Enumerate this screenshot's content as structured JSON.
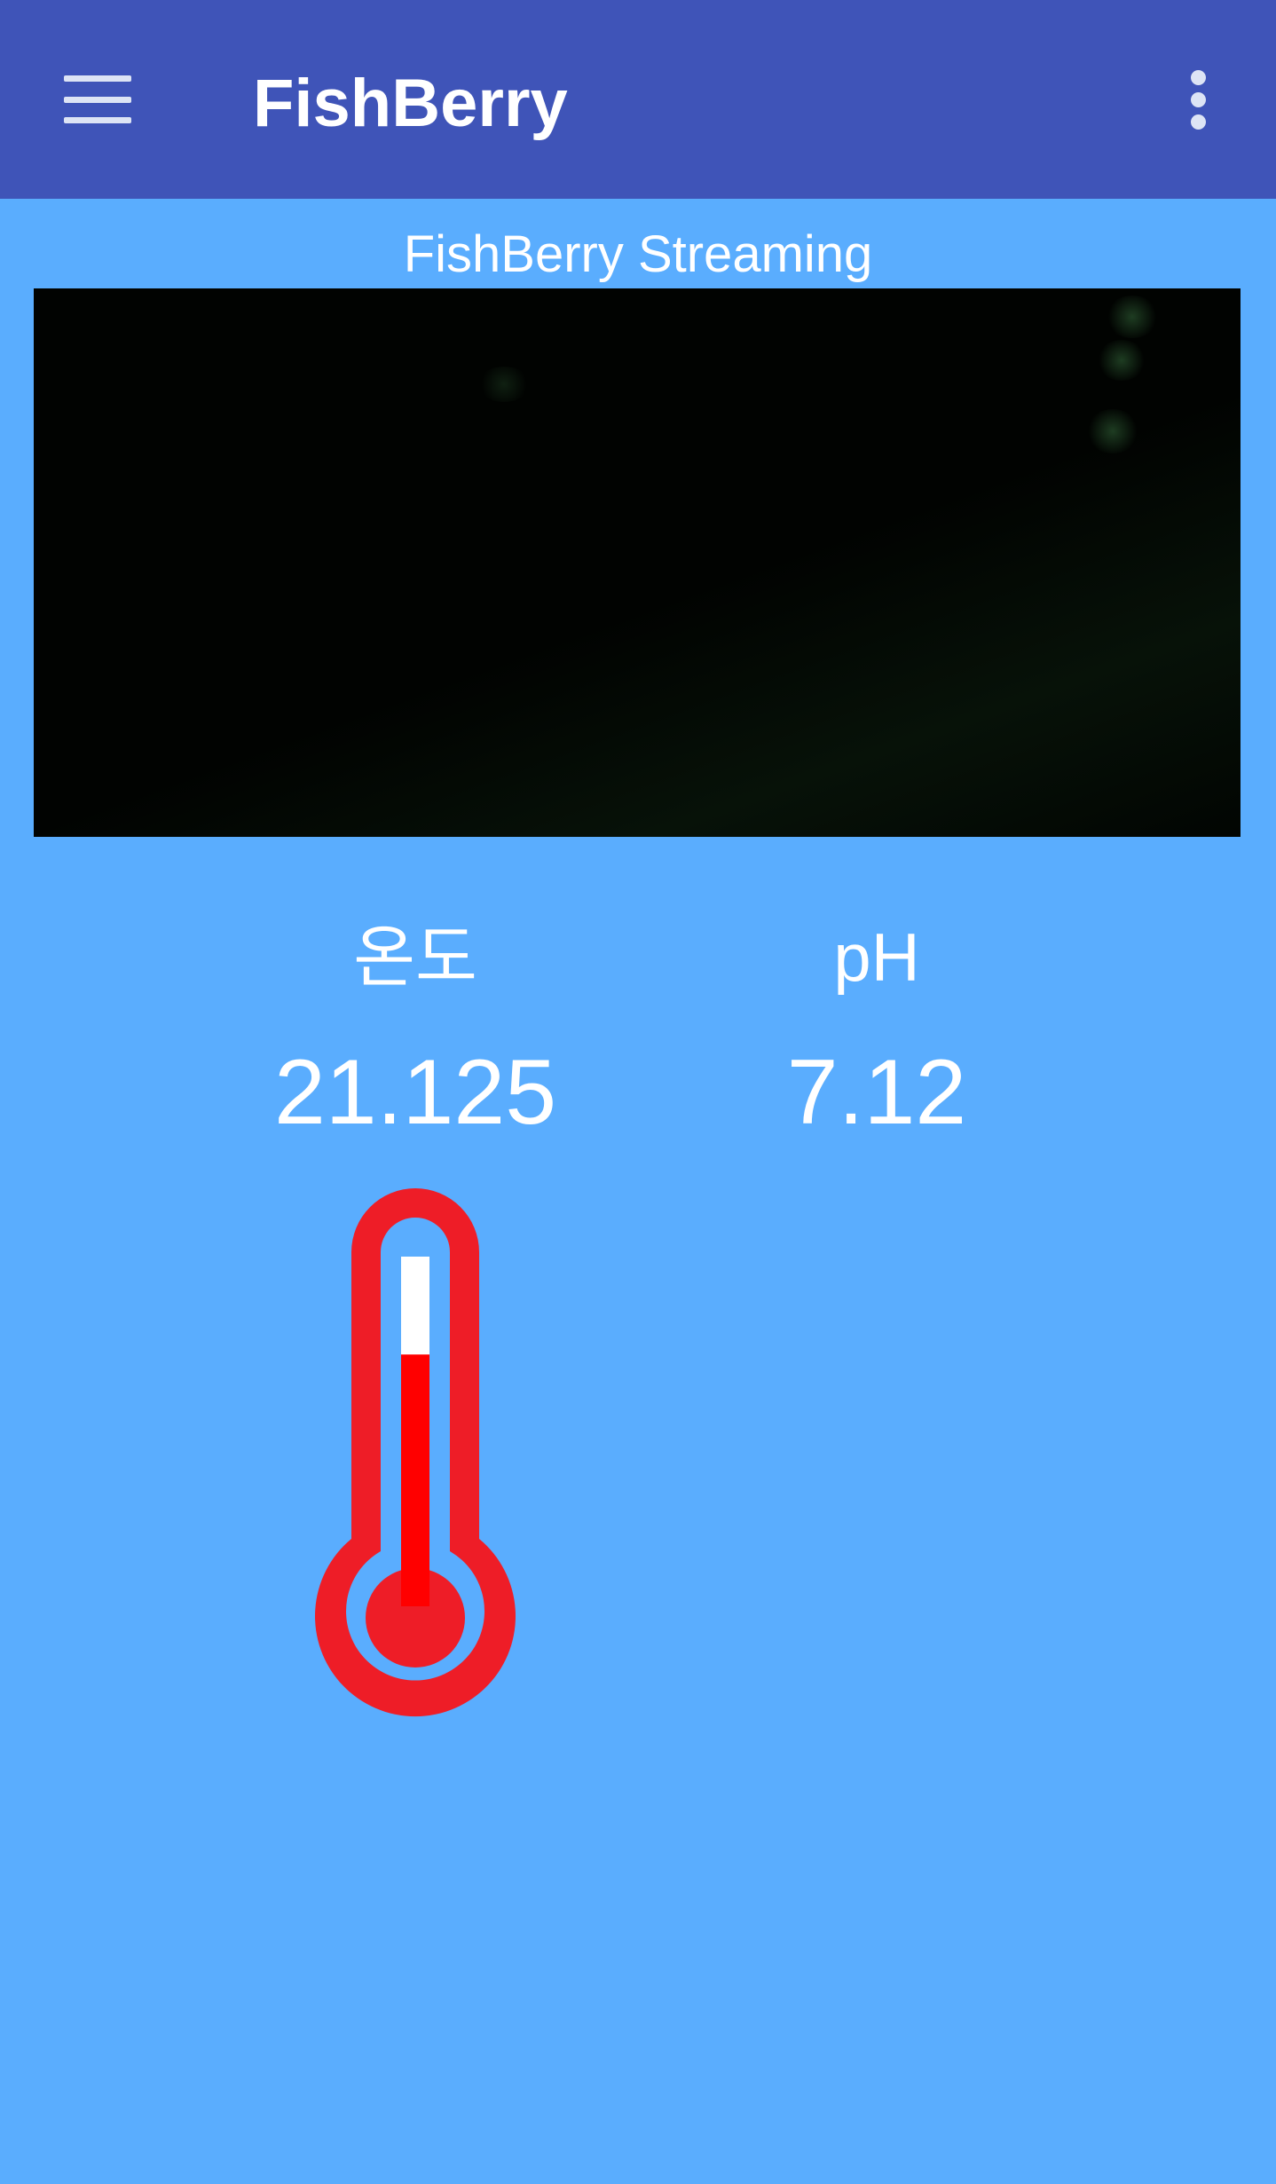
{
  "app_bar": {
    "title": "FishBerry",
    "background": "#3f54b8",
    "menu_icon": "hamburger-menu-icon",
    "overflow_icon": "more-vertical-icon"
  },
  "stream": {
    "title": "FishBerry Streaming"
  },
  "sensors": {
    "temperature": {
      "label": "온도",
      "value": "21.125"
    },
    "ph": {
      "label": "pH",
      "value": "7.12"
    }
  },
  "thermometer": {
    "icon": "thermometer-icon",
    "level_fraction": 0.72,
    "color": "#ee1d27",
    "fill_color": "#ff0000"
  },
  "colors": {
    "page_background": "#5aadfe",
    "text": "#ffffff"
  }
}
